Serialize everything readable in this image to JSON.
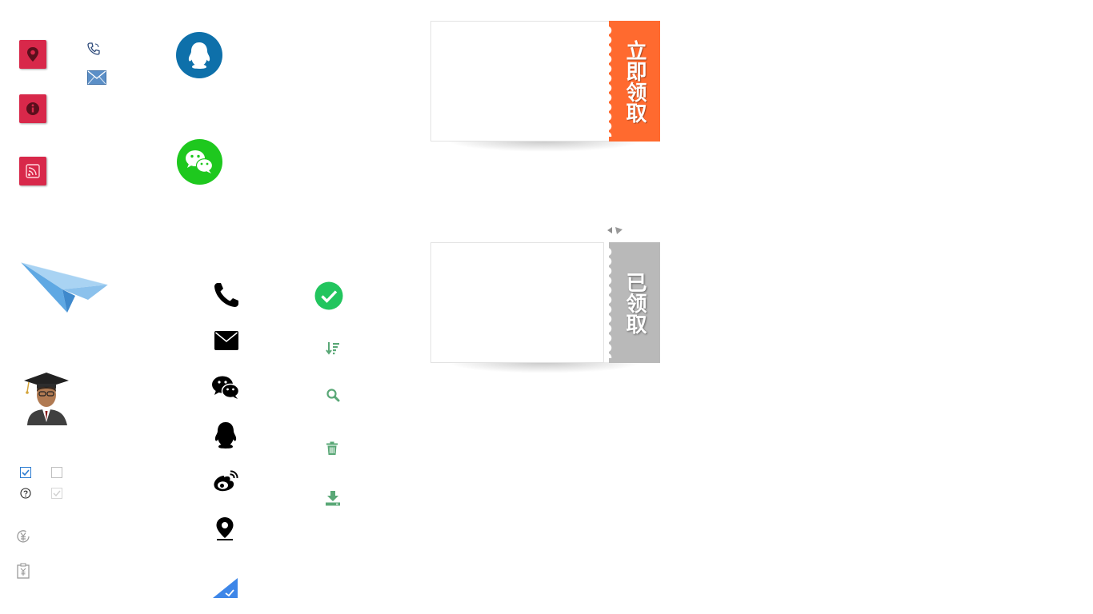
{
  "coupons": {
    "available_label": "立即领取",
    "claimed_label": "已领取",
    "available_color": "#ff6a2f",
    "claimed_color": "#b9b9b9"
  },
  "icons": {
    "red_tiles": [
      "location-pin-icon",
      "info-icon",
      "rss-icon"
    ],
    "contact": [
      "phone-icon",
      "mail-icon"
    ],
    "social": [
      "qq-icon",
      "wechat-icon",
      "weibo-icon"
    ],
    "actions": [
      "check-circle-icon",
      "sort-icon",
      "search-icon",
      "trash-icon",
      "download-icon"
    ],
    "money": [
      "yen-circle-icon",
      "yen-clipboard-icon"
    ]
  },
  "colors": {
    "tile_red": "#d8284a",
    "qq_blue": "#0e70aa",
    "wechat_green": "#1ec81e",
    "action_green": "#5aa877",
    "check_green": "#22c55e",
    "checkbox_blue": "#2a7bd1"
  }
}
